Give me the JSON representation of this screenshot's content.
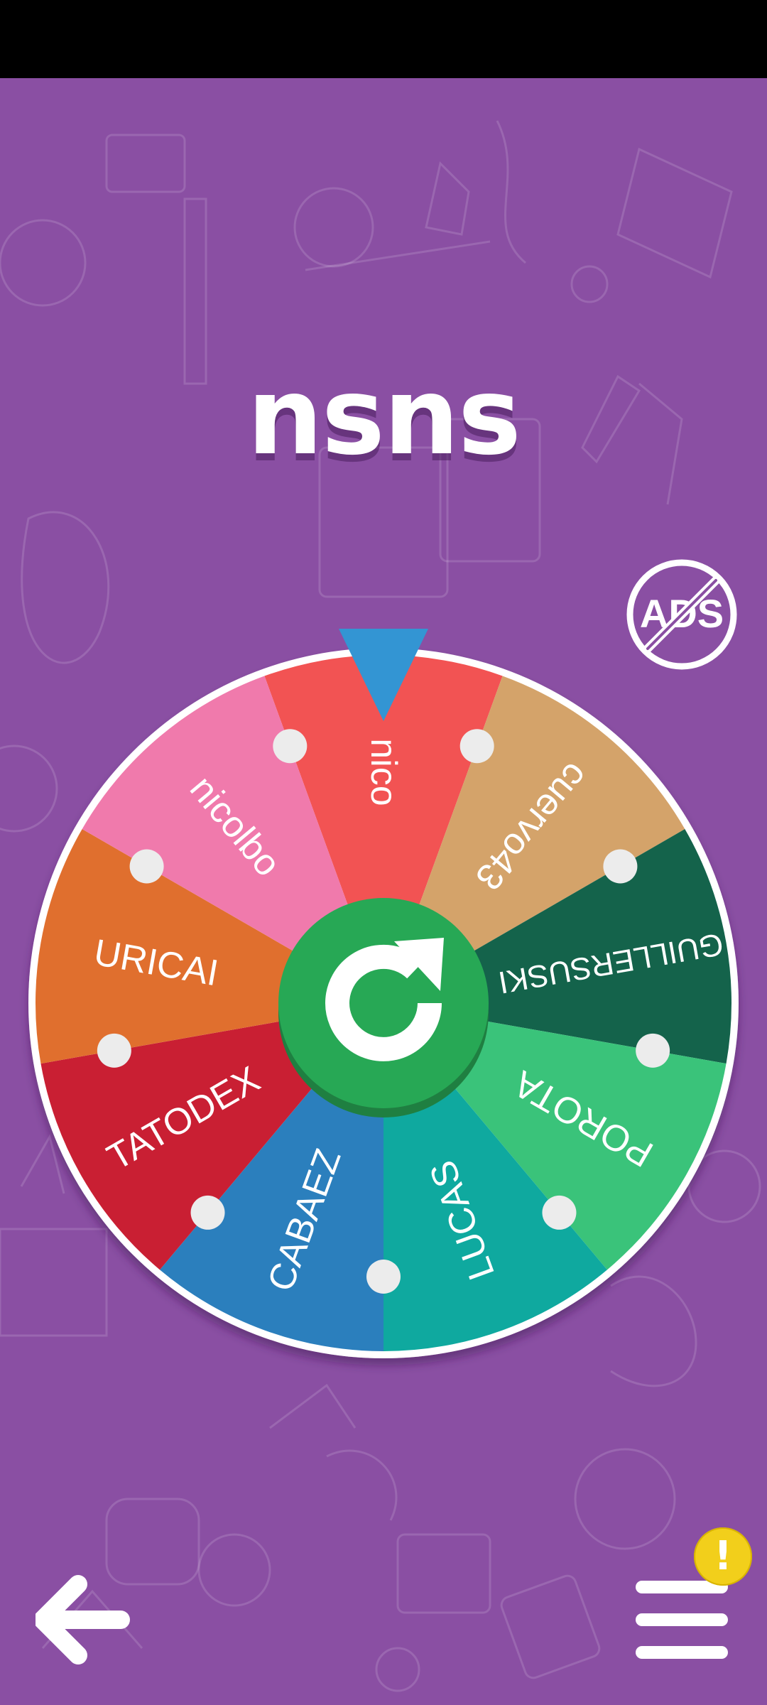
{
  "title": "nsns",
  "ads_badge": "ADS",
  "wheel": {
    "segments": [
      {
        "label": "nico",
        "color": "#f25353"
      },
      {
        "label": "cuervo43",
        "color": "#d4a36a"
      },
      {
        "label": "GUILLERSUSKI",
        "color": "#14634b"
      },
      {
        "label": "POROTA",
        "color": "#3ac37a"
      },
      {
        "label": "LUCAS",
        "color": "#0fa99f"
      },
      {
        "label": "CABAEZ",
        "color": "#2b7fbd"
      },
      {
        "label": "TATODEX",
        "color": "#c91f33"
      },
      {
        "label": "URICAI",
        "color": "#e06f2e"
      },
      {
        "label": "nicolbo",
        "color": "#f07aac"
      }
    ],
    "pointer_color": "#3395d3",
    "spin_button_color": "#27a855",
    "spin_icon": "refresh-icon"
  },
  "nav": {
    "back_icon": "arrow-left-icon",
    "menu_icon": "hamburger-menu-icon",
    "alert_text": "!"
  }
}
